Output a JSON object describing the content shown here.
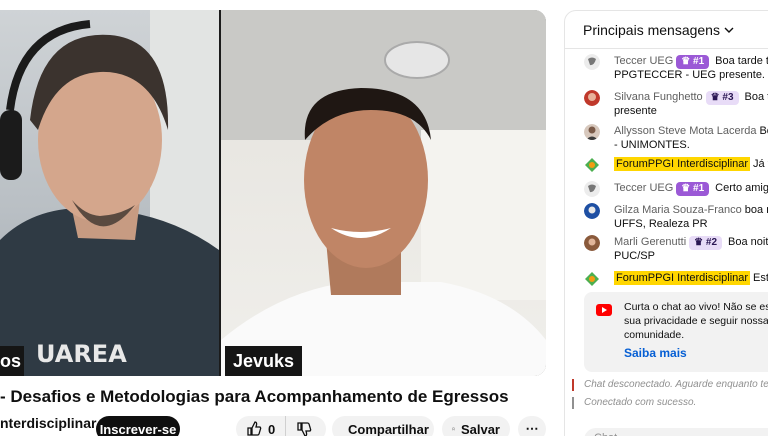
{
  "video": {
    "left_name_partial": "os",
    "right_name": "Jevuks",
    "shirt_text": "UAREA"
  },
  "title": "- Desafios e Metodologias para Acompanhamento de Egressos",
  "channel": "nterdisciplinar",
  "subscribe_label": "Inscrever-se",
  "like_count": "0",
  "share_label": "Compartilhar",
  "save_label": "Salvar",
  "more_label": "⋯",
  "chat": {
    "header": "Principais mensagens",
    "messages": [
      {
        "author": "Teccer UEG",
        "badge": "#1",
        "badge_style": "dark",
        "text": "Boa tarde tur",
        "line2": "PPGTECCER - UEG presente.",
        "avatar_color": "#e8e8e8"
      },
      {
        "author": "Silvana Funghetto",
        "badge": "#3",
        "badge_style": "light",
        "text": "Boa tro",
        "line2": "presente",
        "avatar_color": "#c0392b"
      },
      {
        "author": "Allysson Steve Mota Lacerda",
        "badge": "",
        "badge_style": "",
        "text": "Boa t",
        "line2": "- UNIMONTES.",
        "avatar_color": "#7a5a48"
      },
      {
        "author": "ForumPPGI Interdisciplinar",
        "badge": "",
        "badge_style": "highlight",
        "text": "Já var",
        "line2": "",
        "avatar_color": "#4caf50"
      },
      {
        "author": "Teccer UEG",
        "badge": "#1",
        "badge_style": "dark",
        "text": "Certo amigo.",
        "line2": "",
        "avatar_color": "#e8e8e8"
      },
      {
        "author": "Gilza Maria Souza-Franco",
        "badge": "",
        "badge_style": "",
        "text": "boa noite",
        "line2": "UFFS, Realeza PR",
        "avatar_color": "#1e4fa3"
      },
      {
        "author": "Marli Gerenutti",
        "badge": "#2",
        "badge_style": "light",
        "text": "Boa noite!",
        "line2": "PUC/SP",
        "avatar_color": "#8a5a3c"
      },
      {
        "author": "ForumPPGI Interdisciplinar",
        "badge": "",
        "badge_style": "highlight",
        "text": "Estam",
        "line2": "",
        "avatar_color": "#4caf50"
      }
    ],
    "notice": {
      "line1": "Curta o chat ao vivo! Não se esqueç",
      "line2": "sua privacidade e seguir nossas dire",
      "line3": "comunidade.",
      "link": "Saiba mais"
    },
    "system_disconnected": "Chat desconectado. Aguarde enquanto tentam",
    "system_connected": "Conectado com sucesso.",
    "input_placeholder": "Chat..."
  },
  "colors": {
    "badge": "#9b59d6",
    "highlight": "#ffd600",
    "link": "#065fd4",
    "youtube_red": "#ff0000"
  }
}
